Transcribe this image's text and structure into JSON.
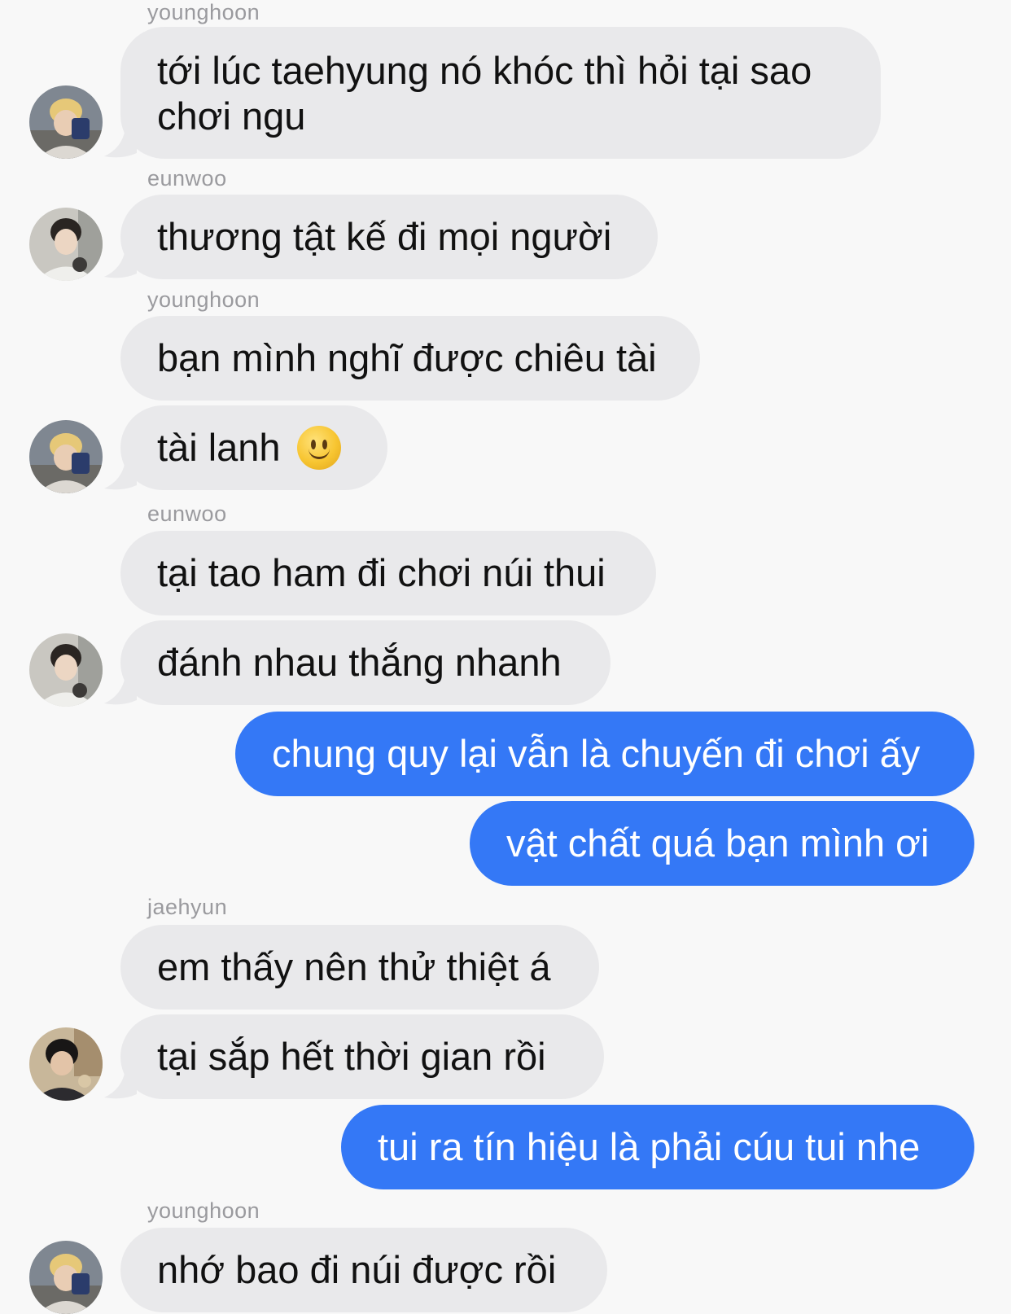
{
  "messages": [
    {
      "sender": "younghoon",
      "text": "tới lúc taehyung nó khóc thì hỏi tại sao\nchơi ngu"
    },
    {
      "sender": "eunwoo",
      "text": "thương tật kế đi mọi người"
    },
    {
      "sender": "younghoon",
      "text": "bạn mình nghĩ được chiêu tài"
    },
    {
      "sender": "",
      "text": "tài lanh"
    },
    {
      "sender": "eunwoo",
      "text": "tại tao ham đi chơi núi thui"
    },
    {
      "sender": "",
      "text": "đánh nhau thắng nhanh"
    },
    {
      "sender": "me",
      "text": "chung quy lại vẫn là chuyến đi chơi ấy"
    },
    {
      "sender": "me",
      "text": "vật chất quá bạn mình ơi"
    },
    {
      "sender": "jaehyun",
      "text": "em thấy nên thử thiệt á"
    },
    {
      "sender": "",
      "text": "tại sắp hết thời gian rồi"
    },
    {
      "sender": "me",
      "text": "tui ra tín hiệu là phải cúu tui nhe"
    },
    {
      "sender": "younghoon",
      "text": "nhớ bao đi núi được rồi"
    }
  ],
  "names": {
    "n1": "younghoon",
    "n2": "eunwoo",
    "n3": "younghoon",
    "n4": "eunwoo",
    "n5": "jaehyun",
    "n6": "younghoon"
  },
  "emoji": "slightly-smiling-face-icon",
  "colors": {
    "incoming": "#e9e9eb",
    "outgoing": "#3478f6",
    "background": "#f8f8f8"
  }
}
